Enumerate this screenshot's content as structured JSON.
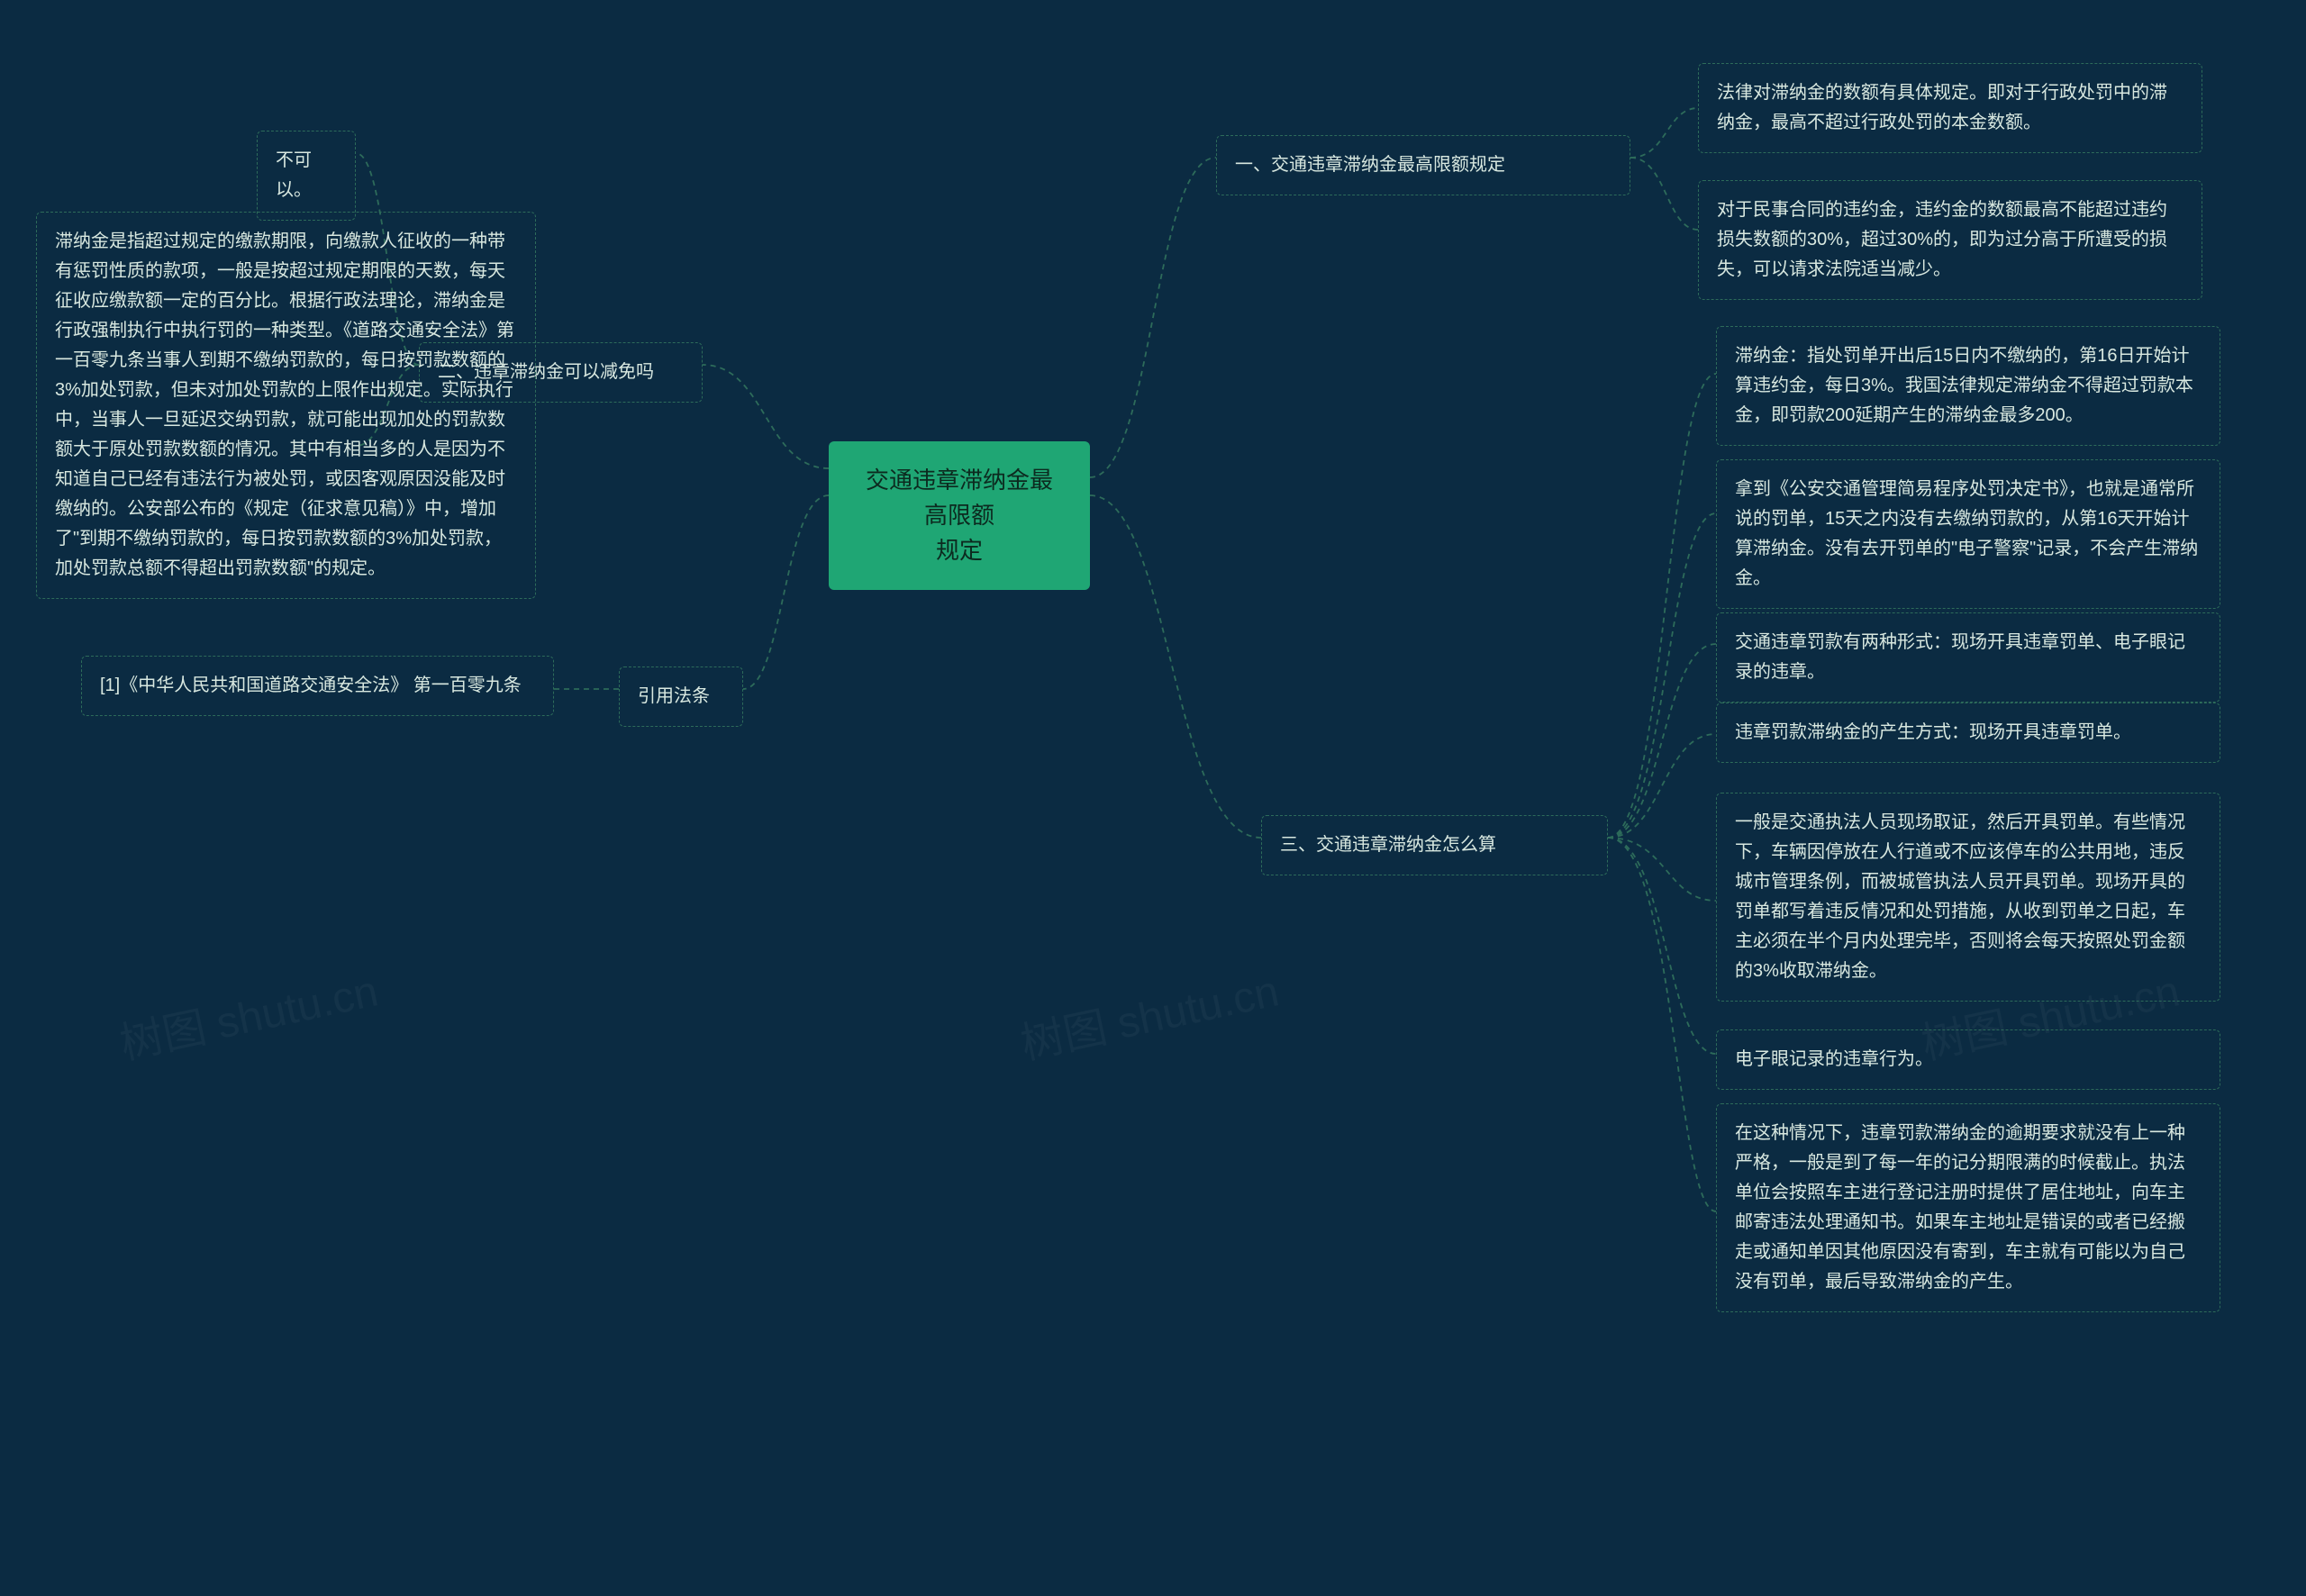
{
  "root": {
    "line1": "交通违章滞纳金最高限额",
    "line2": "规定"
  },
  "branches": {
    "b1": {
      "label": "一、交通违章滞纳金最高限额规定",
      "children": [
        "法律对滞纳金的数额有具体规定。即对于行政处罚中的滞纳金，最高不超过行政处罚的本金数额。",
        "对于民事合同的违约金，违约金的数额最高不能超过违约损失数额的30%，超过30%的，即为过分高于所遭受的损失，可以请求法院适当减少。"
      ]
    },
    "b2": {
      "label": "二、违章滞纳金可以减免吗",
      "children": [
        "不可以。",
        "滞纳金是指超过规定的缴款期限，向缴款人征收的一种带有惩罚性质的款项，一般是按超过规定期限的天数，每天征收应缴款额一定的百分比。根据行政法理论，滞纳金是行政强制执行中执行罚的一种类型。《道路交通安全法》第一百零九条当事人到期不缴纳罚款的，每日按罚款数额的3%加处罚款，但未对加处罚款的上限作出规定。实际执行中，当事人一旦延迟交纳罚款，就可能出现加处的罚款数额大于原处罚款数额的情况。其中有相当多的人是因为不知道自己已经有违法行为被处罚，或因客观原因没能及时缴纳的。公安部公布的《规定（征求意见稿）》中，增加了\"到期不缴纳罚款的，每日按罚款数额的3%加处罚款，加处罚款总额不得超出罚款数额\"的规定。"
      ]
    },
    "b3": {
      "label": "三、交通违章滞纳金怎么算",
      "children": [
        "滞纳金：指处罚单开出后15日内不缴纳的，第16日开始计算违约金，每日3%。我国法律规定滞纳金不得超过罚款本金，即罚款200延期产生的滞纳金最多200。",
        "拿到《公安交通管理简易程序处罚决定书》，也就是通常所说的罚单，15天之内没有去缴纳罚款的，从第16天开始计算滞纳金。没有去开罚单的\"电子警察\"记录，不会产生滞纳金。",
        "交通违章罚款有两种形式：现场开具违章罚单、电子眼记录的违章。",
        "违章罚款滞纳金的产生方式：现场开具违章罚单。",
        "一般是交通执法人员现场取证，然后开具罚单。有些情况下，车辆因停放在人行道或不应该停车的公共用地，违反城市管理条例，而被城管执法人员开具罚单。现场开具的罚单都写着违反情况和处罚措施，从收到罚单之日起，车主必须在半个月内处理完毕，否则将会每天按照处罚金额的3%收取滞纳金。",
        "电子眼记录的违章行为。",
        "在这种情况下，违章罚款滞纳金的逾期要求就没有上一种严格，一般是到了每一年的记分期限满的时候截止。执法单位会按照车主进行登记注册时提供了居住地址，向车主邮寄违法处理通知书。如果车主地址是错误的或者已经搬走或通知单因其他原因没有寄到，车主就有可能以为自己没有罚单，最后导致滞纳金的产生。"
      ]
    },
    "b4": {
      "label": "引用法条",
      "children": [
        "[1]《中华人民共和国道路交通安全法》 第一百零九条"
      ]
    }
  },
  "watermarks": [
    "树图 shutu.cn",
    "树图 shutu.cn",
    "树图 shutu.cn"
  ]
}
